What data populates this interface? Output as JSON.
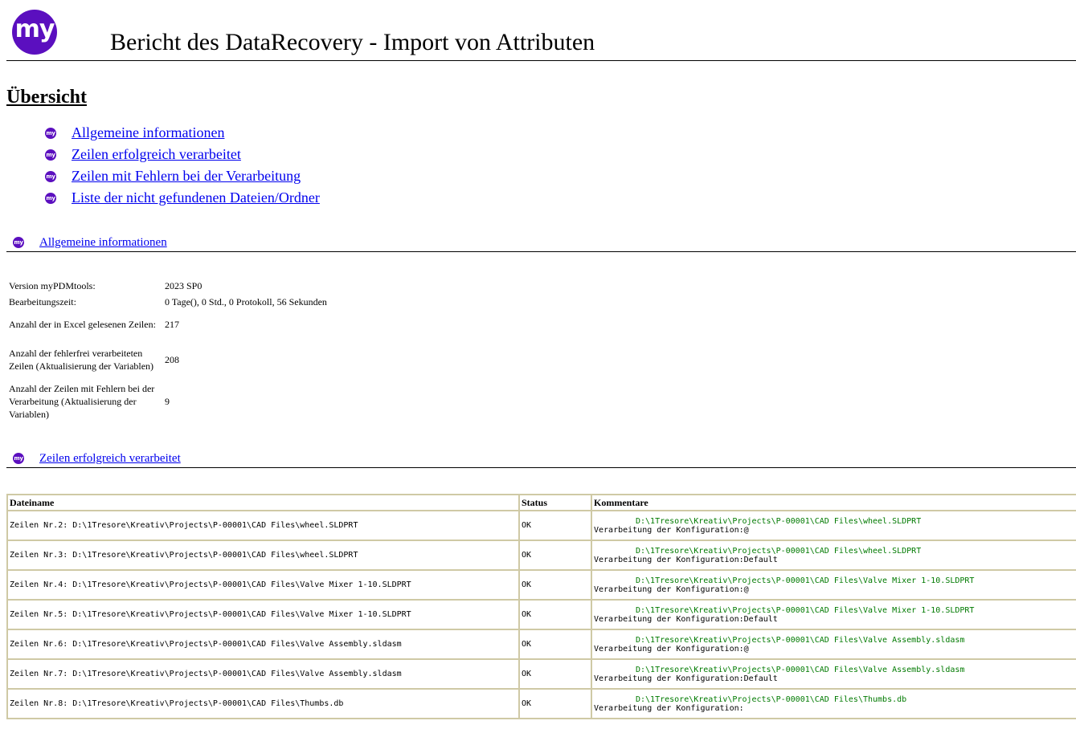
{
  "header": {
    "logo_text": "my",
    "title": "Bericht des DataRecovery - Import von Attributen"
  },
  "overview": {
    "heading": "Übersicht",
    "links": [
      "Allgemeine informationen",
      "Zeilen erfolgreich verarbeitet",
      "Zeilen mit Fehlern bei der Verarbeitung",
      "Liste der nicht gefundenen Dateien/Ordner"
    ]
  },
  "general": {
    "heading": "Allgemeine informationen",
    "rows": [
      {
        "label": "Version myPDMtools:",
        "value": "2023 SP0"
      },
      {
        "label": "Bearbeitungszeit:",
        "value": "0 Tage(), 0 Std., 0 Protokoll, 56 Sekunden"
      },
      {
        "label": "Anzahl der in Excel gelesenen Zeilen:",
        "value": "217"
      },
      {
        "label": "Anzahl der fehlerfrei verarbeiteten Zeilen (Aktualisierung der Variablen)",
        "value": "208"
      },
      {
        "label": "Anzahl der Zeilen mit Fehlern bei der Verarbeitung (Aktualisierung der Variablen)",
        "value": "9"
      }
    ]
  },
  "success": {
    "heading": "Zeilen erfolgreich verarbeitet",
    "columns": [
      "Dateiname",
      "Status",
      "Kommentare"
    ],
    "rows": [
      {
        "file": "Zeilen Nr.2: D:\\1Tresore\\Kreativ\\Projects\\P-00001\\CAD Files\\wheel.SLDPRT",
        "status": "OK",
        "path": "D:\\1Tresore\\Kreativ\\Projects\\P-00001\\CAD Files\\wheel.SLDPRT",
        "config": "Verarbeitung der Konfiguration:@"
      },
      {
        "file": "Zeilen Nr.3: D:\\1Tresore\\Kreativ\\Projects\\P-00001\\CAD Files\\wheel.SLDPRT",
        "status": "OK",
        "path": "D:\\1Tresore\\Kreativ\\Projects\\P-00001\\CAD Files\\wheel.SLDPRT",
        "config": "Verarbeitung der Konfiguration:Default"
      },
      {
        "file": "Zeilen Nr.4: D:\\1Tresore\\Kreativ\\Projects\\P-00001\\CAD Files\\Valve Mixer 1-10.SLDPRT",
        "status": "OK",
        "path": "D:\\1Tresore\\Kreativ\\Projects\\P-00001\\CAD Files\\Valve Mixer 1-10.SLDPRT",
        "config": "Verarbeitung der Konfiguration:@"
      },
      {
        "file": "Zeilen Nr.5: D:\\1Tresore\\Kreativ\\Projects\\P-00001\\CAD Files\\Valve Mixer 1-10.SLDPRT",
        "status": "OK",
        "path": "D:\\1Tresore\\Kreativ\\Projects\\P-00001\\CAD Files\\Valve Mixer 1-10.SLDPRT",
        "config": "Verarbeitung der Konfiguration:Default"
      },
      {
        "file": "Zeilen Nr.6: D:\\1Tresore\\Kreativ\\Projects\\P-00001\\CAD Files\\Valve Assembly.sldasm",
        "status": "OK",
        "path": "D:\\1Tresore\\Kreativ\\Projects\\P-00001\\CAD Files\\Valve Assembly.sldasm",
        "config": "Verarbeitung der Konfiguration:@"
      },
      {
        "file": "Zeilen Nr.7: D:\\1Tresore\\Kreativ\\Projects\\P-00001\\CAD Files\\Valve Assembly.sldasm",
        "status": "OK",
        "path": "D:\\1Tresore\\Kreativ\\Projects\\P-00001\\CAD Files\\Valve Assembly.sldasm",
        "config": "Verarbeitung der Konfiguration:Default"
      },
      {
        "file": "Zeilen Nr.8: D:\\1Tresore\\Kreativ\\Projects\\P-00001\\CAD Files\\Thumbs.db",
        "status": "OK",
        "path": "D:\\1Tresore\\Kreativ\\Projects\\P-00001\\CAD Files\\Thumbs.db",
        "config": "Verarbeitung der Konfiguration:"
      }
    ]
  },
  "colors": {
    "brand": "#5b0fbf",
    "link": "#0000ee",
    "path_text": "#007a00",
    "table_border": "#cfc9a5"
  },
  "icons": {
    "logo": "my-logo-icon",
    "bullet": "my-bullet-icon"
  }
}
